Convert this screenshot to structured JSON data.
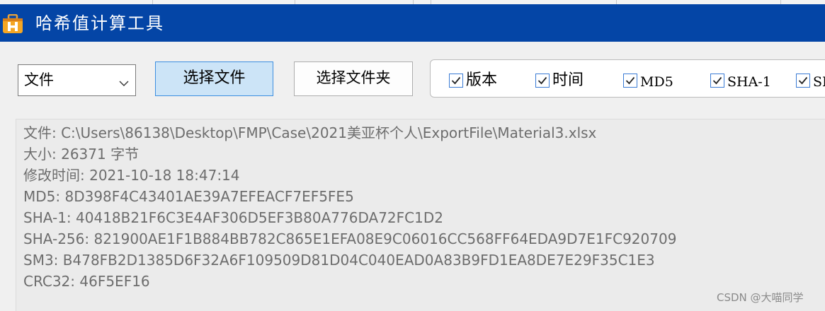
{
  "window": {
    "title": "哈希值计算工具",
    "title_bg": "#0445a6",
    "app_icon": "toolbox-h-icon"
  },
  "toolbar": {
    "mode_select": {
      "value": "文件"
    },
    "select_file_label": "选择文件",
    "select_folder_label": "选择文件夹"
  },
  "options": [
    {
      "label": "版本",
      "checked": true
    },
    {
      "label": "时间",
      "checked": true
    },
    {
      "label": "MD5",
      "checked": true
    },
    {
      "label": "SHA-1",
      "checked": true
    },
    {
      "label": "SI",
      "checked": true
    }
  ],
  "output": {
    "lines": [
      "文件: C:\\Users\\86138\\Desktop\\FMP\\Case\\2021美亚杯个人\\ExportFile\\Material3.xlsx",
      "大小: 26371 字节",
      "修改时间: 2021-10-18 18:47:14",
      "MD5: 8D398F4C43401AE39A7EFEACF7EF5FE5",
      "SHA-1: 40418B21F6C3E4AF306D5EF3B80A776DA72FC1D2",
      "SHA-256: 821900AE1F1B884BB782C865E1EFA08E9C06016CC568FF64EDA9D7E1FC920709",
      "SM3: B478FB2D1385D6F32A6F109509D81D04C040EAD0A83B9FD1EA8DE7E29F35C1E3",
      "CRC32: 46F5EF16"
    ]
  },
  "watermark": "CSDN @大喵同学"
}
